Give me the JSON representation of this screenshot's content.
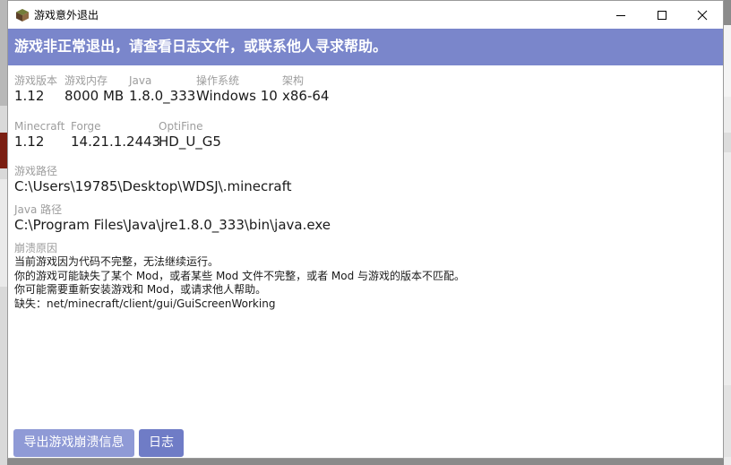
{
  "window": {
    "title": "游戏意外退出"
  },
  "banner": {
    "message": "游戏非正常退出，请查看日志文件，或联系他人寻求帮助。"
  },
  "info_row1": [
    {
      "label": "游戏版本",
      "value": "1.12"
    },
    {
      "label": "游戏内存",
      "value": "8000 MB"
    },
    {
      "label": "Java",
      "value": "1.8.0_333"
    },
    {
      "label": "操作系统",
      "value": "Windows 10"
    },
    {
      "label": "架构",
      "value": "x86-64"
    }
  ],
  "info_row2": [
    {
      "label": "Minecraft",
      "value": "1.12"
    },
    {
      "label": "Forge",
      "value": "14.21.1.2443"
    },
    {
      "label": "OptiFine",
      "value": "HD_U_G5"
    }
  ],
  "game_path": {
    "label": "游戏路径",
    "value": "C:\\Users\\19785\\Desktop\\WDSJ\\.minecraft"
  },
  "java_path": {
    "label": "Java 路径",
    "value": "C:\\Program Files\\Java\\jre1.8.0_333\\bin\\java.exe"
  },
  "crash_reason": {
    "label": "崩溃原因",
    "lines": [
      "当前游戏因为代码不完整，无法继续运行。",
      "你的游戏可能缺失了某个 Mod，或者某些 Mod 文件不完整，或者 Mod 与游戏的版本不匹配。",
      "你可能需要重新安装游戏和 Mod，或请求他人帮助。",
      "缺失：net/minecraft/client/gui/GuiScreenWorking"
    ]
  },
  "buttons": {
    "export": "导出游戏崩溃信息",
    "log": "日志"
  },
  "colors": {
    "accent": "#7a86cb",
    "button_primary": "#6f7cc6",
    "button_secondary": "#8f9ad6"
  },
  "icons": {
    "app": "minecraft-block-icon",
    "minimize": "minimize-icon",
    "maximize": "maximize-icon",
    "close": "close-icon"
  }
}
